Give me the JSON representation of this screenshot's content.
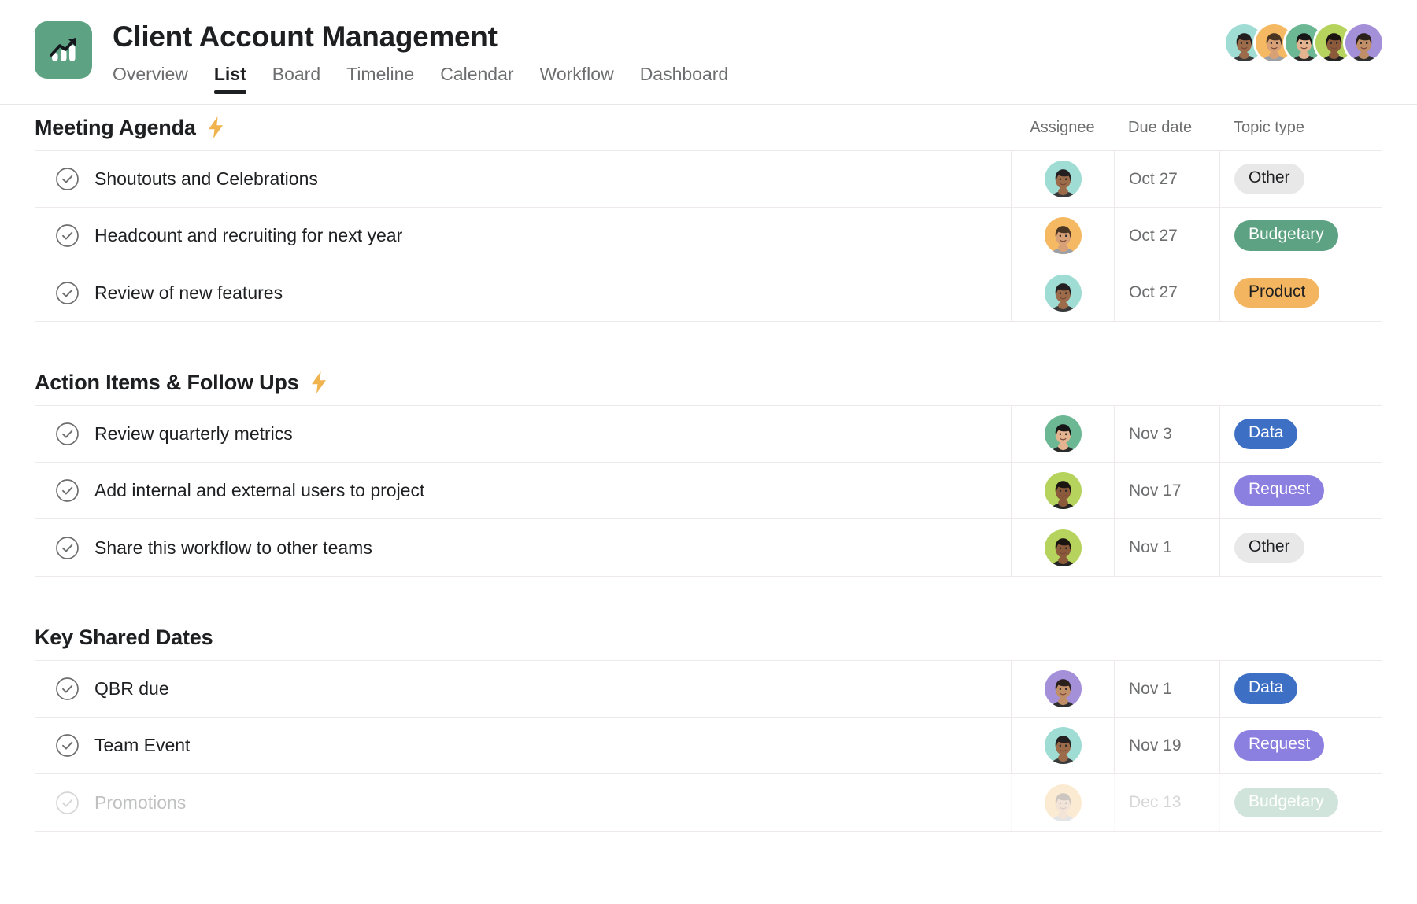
{
  "header": {
    "project_icon": "chart-growth-icon",
    "icon_bg": "#5da283",
    "title": "Client Account Management",
    "tabs": [
      {
        "label": "Overview",
        "active": false
      },
      {
        "label": "List",
        "active": true
      },
      {
        "label": "Board",
        "active": false
      },
      {
        "label": "Timeline",
        "active": false
      },
      {
        "label": "Calendar",
        "active": false
      },
      {
        "label": "Workflow",
        "active": false
      },
      {
        "label": "Dashboard",
        "active": false
      }
    ],
    "members": [
      {
        "name": "member-avatar-1",
        "bg": "#9fdcd4",
        "skin": "#9c6b4a",
        "hair": "#231f20",
        "shirt": "#3a3a3a"
      },
      {
        "name": "member-avatar-2",
        "bg": "#f5b963",
        "skin": "#d7a077",
        "hair": "#4a3422",
        "shirt": "#9aa0a6"
      },
      {
        "name": "member-avatar-3",
        "bg": "#6cb894",
        "skin": "#e3b48f",
        "hair": "#171717",
        "shirt": "#2b2b2b"
      },
      {
        "name": "member-avatar-4",
        "bg": "#b5d35d",
        "skin": "#8a5a3b",
        "hair": "#1b1512",
        "shirt": "#242424"
      },
      {
        "name": "member-avatar-5",
        "bg": "#a490d8",
        "skin": "#c08f68",
        "hair": "#2a211c",
        "shirt": "#2f2f2f"
      }
    ]
  },
  "columns": {
    "assignee": "Assignee",
    "due_date": "Due date",
    "topic_type": "Topic type"
  },
  "tag_colors": {
    "Other": {
      "bg": "#e8e8e8",
      "fg": "#1e1f21"
    },
    "Budgetary": {
      "bg": "#5da283",
      "fg": "#ffffff"
    },
    "Product": {
      "bg": "#f3b55f",
      "fg": "#1e1f21"
    },
    "Data": {
      "bg": "#3d6fc4",
      "fg": "#ffffff"
    },
    "Request": {
      "bg": "#8b7fe0",
      "fg": "#ffffff"
    }
  },
  "sections": [
    {
      "title": "Meeting Agenda",
      "has_bolt": true,
      "show_headers": true,
      "tasks": [
        {
          "name": "Shoutouts and Celebrations",
          "due": "Oct 27",
          "tag": "Other",
          "avatar": 0,
          "faded": false
        },
        {
          "name": "Headcount and recruiting for next year",
          "due": "Oct 27",
          "tag": "Budgetary",
          "avatar": 1,
          "faded": false
        },
        {
          "name": "Review of new features",
          "due": "Oct 27",
          "tag": "Product",
          "avatar": 0,
          "faded": false
        }
      ]
    },
    {
      "title": "Action Items & Follow Ups",
      "has_bolt": true,
      "show_headers": false,
      "tasks": [
        {
          "name": "Review quarterly metrics",
          "due": "Nov 3",
          "tag": "Data",
          "avatar": 2,
          "faded": false
        },
        {
          "name": "Add internal and external users to project",
          "due": "Nov 17",
          "tag": "Request",
          "avatar": 3,
          "faded": false
        },
        {
          "name": "Share this workflow to other teams",
          "due": "Nov 1",
          "tag": "Other",
          "avatar": 3,
          "faded": false
        }
      ]
    },
    {
      "title": "Key Shared Dates",
      "has_bolt": false,
      "show_headers": false,
      "tasks": [
        {
          "name": "QBR due",
          "due": "Nov 1",
          "tag": "Data",
          "avatar": 4,
          "faded": false
        },
        {
          "name": "Team Event",
          "due": "Nov 19",
          "tag": "Request",
          "avatar": 0,
          "faded": false
        },
        {
          "name": "Promotions",
          "due": "Dec 13",
          "tag": "Budgetary",
          "avatar": 1,
          "faded": true
        }
      ]
    }
  ]
}
